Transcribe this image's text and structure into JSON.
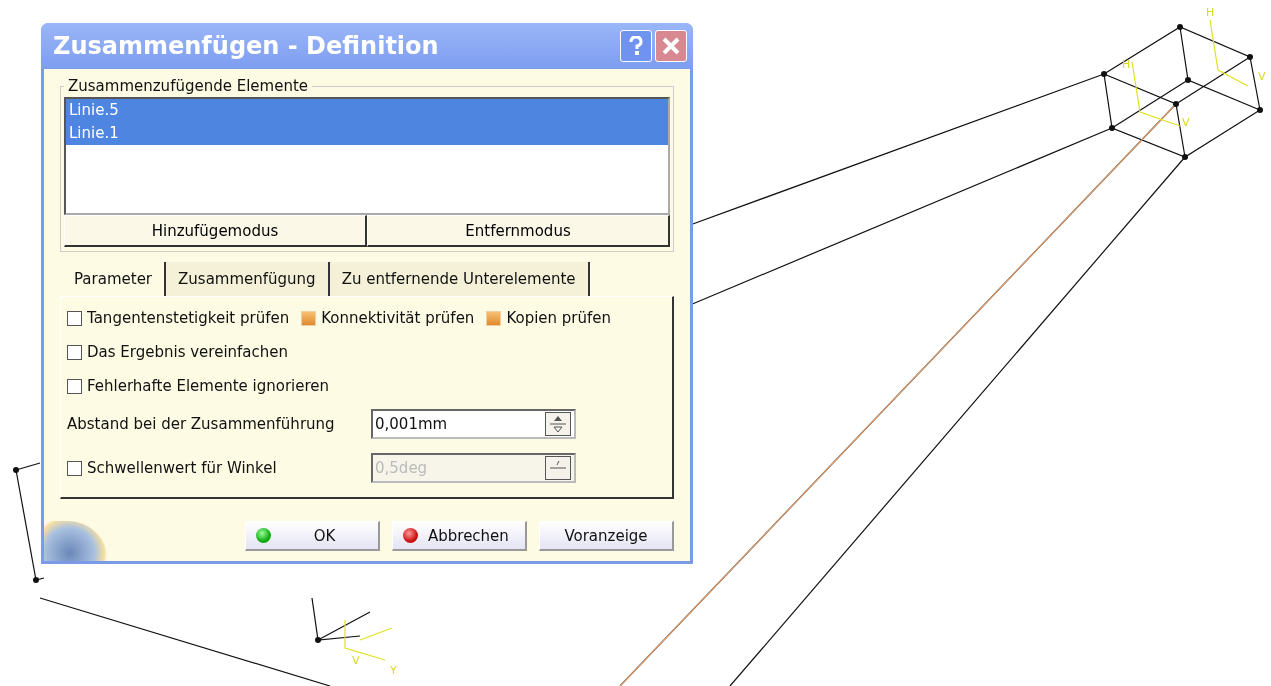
{
  "window": {
    "title": "Zusammenfügen - Definition"
  },
  "elements_group": {
    "label": "Zusammenzufügende Elemente",
    "items": [
      {
        "label": "Linie.5",
        "selected": true
      },
      {
        "label": "Linie.1",
        "selected": true
      }
    ],
    "mode_buttons": [
      "Hinzufügemodus",
      "Entfernmodus"
    ]
  },
  "tabs": [
    {
      "label": "Parameter",
      "selected": true
    },
    {
      "label": "Zusammenfügung",
      "selected": false
    },
    {
      "label": "Zu entfernende Unterelemente",
      "selected": false
    }
  ],
  "option_rows": [
    [
      {
        "label": "Tangentenstetigkeit prüfen",
        "checked": false
      },
      {
        "label": "Konnektivität prüfen",
        "checked": true
      },
      {
        "label": "Kopien prüfen",
        "checked": true
      }
    ],
    [
      {
        "label": "Das Ergebnis vereinfachen",
        "checked": false
      }
    ],
    [
      {
        "label": "Fehlerhafte Elemente ignorieren",
        "checked": false
      }
    ]
  ],
  "fields": [
    {
      "kind": "label",
      "label": "Abstand bei der Zusammenführung",
      "value": "0,001mm",
      "disabled": false
    },
    {
      "kind": "checkbox",
      "label": "Schwellenwert für Winkel",
      "checked": false,
      "value": "0,5deg",
      "disabled": true
    }
  ],
  "buttons": [
    {
      "label": "OK",
      "kind": "ok"
    },
    {
      "label": "Abbrechen",
      "kind": "cancel"
    },
    {
      "label": "Voranzeige",
      "kind": "plain"
    }
  ],
  "viewport": {
    "axis_labels": [
      "H",
      "V",
      "H",
      "V",
      "V",
      "Y"
    ]
  }
}
